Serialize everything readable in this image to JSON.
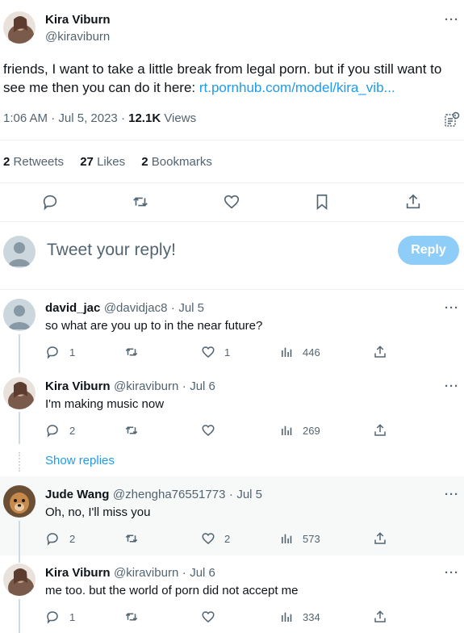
{
  "main_tweet": {
    "author_name": "Kira Viburn",
    "author_handle": "@kiraviburn",
    "text_line1": "friends, I want to take a little break from legal porn. but if you still want to",
    "text_line2_prefix": "see me then you can do it here: ",
    "link_text": "rt.pornhub.com/model/kira_vib...",
    "time": "1:06 AM",
    "date": "Jul 5, 2023",
    "views_count": "12.1K",
    "views_label": "Views",
    "retweets_count": "2",
    "retweets_label": "Retweets",
    "likes_count": "27",
    "likes_label": "Likes",
    "bookmarks_count": "2",
    "bookmarks_label": "Bookmarks"
  },
  "reply_box": {
    "placeholder": "Tweet your reply!",
    "button_label": "Reply"
  },
  "replies": [
    {
      "name": "david_jac",
      "handle": "@davidjac8",
      "date": "Jul 5",
      "text": "so what are you up to in the near future?",
      "replies": "1",
      "retweets": "",
      "likes": "1",
      "views": "446",
      "avatar": "default"
    },
    {
      "name": "Kira Viburn",
      "handle": "@kiraviburn",
      "date": "Jul 6",
      "text": "I'm making music now",
      "replies": "2",
      "retweets": "",
      "likes": "",
      "views": "269",
      "avatar": "kira"
    },
    {
      "name": "Jude Wang",
      "handle": "@zhengha76551773",
      "date": "Jul 5",
      "text": "Oh, no, I'll miss you",
      "replies": "2",
      "retweets": "",
      "likes": "2",
      "views": "573",
      "avatar": "dog"
    },
    {
      "name": "Kira Viburn",
      "handle": "@kiraviburn",
      "date": "Jul 6",
      "text": "me too. but the world of porn did not accept me",
      "replies": "1",
      "retweets": "",
      "likes": "",
      "views": "334",
      "avatar": "kira"
    }
  ],
  "show_replies_label": "Show replies",
  "more_label": "···",
  "separator": "·",
  "colors": {
    "accent": "#1d9bf0",
    "secondary": "#536471",
    "reply_button": "#8ecdf8"
  }
}
